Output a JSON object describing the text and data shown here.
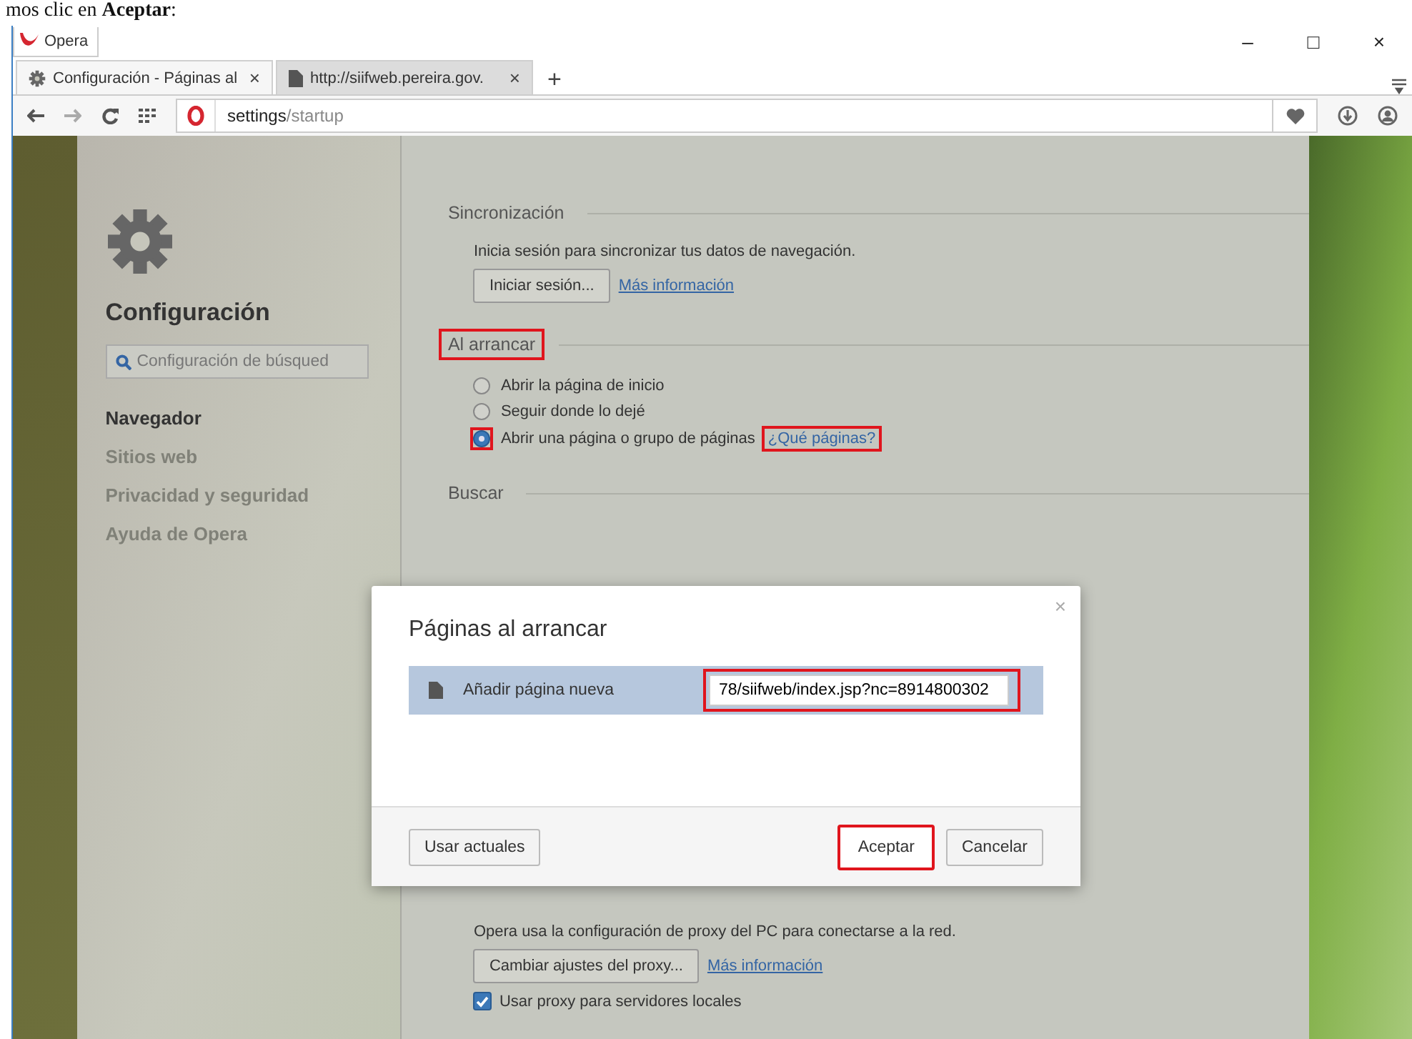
{
  "caption": "mos clic en **Aceptar**:",
  "window": {
    "title": "Opera",
    "controls": [
      "–",
      "□",
      "×"
    ]
  },
  "tabs": [
    {
      "title": "Configuración - Páginas al",
      "selected": true,
      "kind": "settings",
      "close": "×"
    },
    {
      "title": "http://siifweb.pereira.gov.",
      "selected": false,
      "kind": "page",
      "close": "×"
    }
  ],
  "new_tab": "+",
  "address": {
    "host": "settings",
    "path": "/startup"
  },
  "sidebar": {
    "title": "Configuración",
    "search_placeholder": "Configuración de búsqued",
    "items": [
      {
        "label": "Navegador",
        "selected": true
      },
      {
        "label": "Sitios web",
        "selected": false
      },
      {
        "label": "Privacidad y seguridad",
        "selected": false
      },
      {
        "label": "Ayuda de Opera",
        "selected": false
      }
    ]
  },
  "sections": [
    {
      "kind": "sync",
      "title": "Sincronización",
      "highlighted": false,
      "text": "Inicia sesión para sincronizar tus datos de navegación.",
      "button": "Iniciar sesión...",
      "link": "Más información"
    },
    {
      "kind": "startup",
      "title": "Al arrancar",
      "highlighted": true,
      "options": [
        {
          "label": "Abrir la página de inicio",
          "selected": false,
          "highlighted": false
        },
        {
          "label": "Seguir donde lo dejé",
          "selected": false,
          "highlighted": false
        },
        {
          "label": "Abrir una página o grupo de páginas",
          "selected": true,
          "highlighted": true
        }
      ],
      "link": "¿Qué páginas?",
      "link_highlighted": true
    },
    {
      "kind": "heading",
      "title": "Buscar",
      "highlighted": false
    },
    {
      "kind": "proxy",
      "text": "Opera usa la configuración de proxy del PC para conectarse a la red.",
      "button": "Cambiar ajustes del proxy...",
      "link": "Más información",
      "checkbox": {
        "label": "Usar proxy para servidores locales",
        "checked": true
      }
    }
  ],
  "dialog": {
    "title": "Páginas al arrancar",
    "close": "×",
    "row": {
      "label": "Añadir página nueva",
      "value": "78/siifweb/index.jsp?nc=8914800302",
      "highlighted": true
    },
    "buttons": [
      {
        "label": "Usar actuales",
        "highlighted": false
      },
      {
        "label": "Aceptar",
        "highlighted": true
      },
      {
        "label": "Cancelar",
        "highlighted": false
      }
    ]
  }
}
